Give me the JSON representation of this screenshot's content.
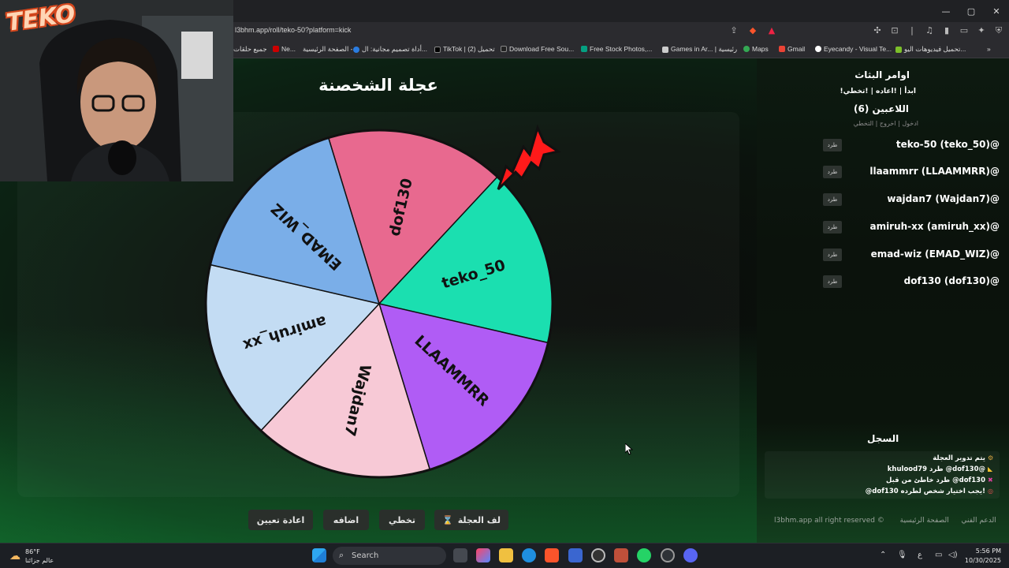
{
  "browser": {
    "url": "l3bhm.app/roll/teko-50?platform=kick",
    "bookmarks": [
      "جميع حلقات",
      "Ne...",
      "الصفحة الرئيسية -",
      "أداة تصميم مجانية: ال...",
      "TikTok | تحميل (2)",
      "Download Free Sou...",
      "Free Stock Photos,...",
      "Games in Ar... | رئيسية",
      "Maps",
      "Gmail",
      "Eyecandy - Visual Te...",
      "تحميل فيديوهات اليو..."
    ]
  },
  "stream_logo": "TEKO",
  "page": {
    "title": "عجلة الشخصنة",
    "wheel_segments": [
      "dof130",
      "teko_50",
      "LLAAMMRR",
      "Wajdan7",
      "amiruh_xx",
      "EMAD_WIZ"
    ],
    "wheel_colors": [
      "#e8698f",
      "#1bdfb0",
      "#b05cf5",
      "#f7c9d6",
      "#c3dcf3",
      "#7aaee8"
    ],
    "buttons": {
      "spin": "لف العجلة",
      "skip": "تخطي",
      "add": "اضافه",
      "reset": "اعادة تعيين"
    }
  },
  "sidebar": {
    "commands_title": "اوامر البثاث",
    "commands": "!ابدأ | !اعاده | !تخطي",
    "players_title": "اللاعبين (6)",
    "players_sub": "ادخول | اخروج | التخطي",
    "kick_label": "طرد",
    "players": [
      "teko-50 (teko_50)@",
      "llaammrr (LLAAMMRR)@",
      "wajdan7 (Wajdan7)@",
      "amiruh-xx (amiruh_xx)@",
      "emad-wiz (EMAD_WIZ)@",
      "dof130 (dof130)@"
    ],
    "log_title": "السجل",
    "log": [
      "يتم تدوير العجلة",
      "khulood79 طرد @dof130@",
      "طرد خاطئ من قبل @dof130",
      "@dof130 يجب اختيار شخص لطرده!"
    ],
    "footer": {
      "home": "الصفحة الرئيسية",
      "support": "الدعم الفني",
      "copyright": "l3bhm.app all right reserved ©"
    }
  },
  "taskbar": {
    "temperature": "86°F",
    "weather": "عالم جزائنا",
    "search": "Search",
    "time": "5:56 PM",
    "date": "10/30/2025",
    "lang": "ع"
  }
}
